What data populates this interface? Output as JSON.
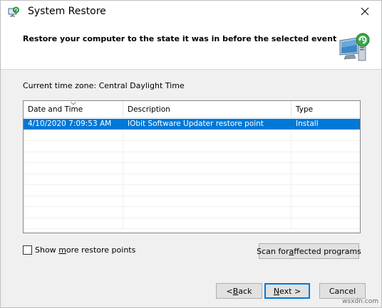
{
  "window": {
    "title": "System Restore"
  },
  "header": {
    "text": "Restore your computer to the state it was in before the selected event"
  },
  "timezone": {
    "text": "Current time zone: Central Daylight Time"
  },
  "table": {
    "columns": [
      "Date and Time",
      "Description",
      "Type"
    ],
    "rows": [
      {
        "date": "4/10/2020 7:09:53 AM",
        "description": "IObit Software Updater restore point",
        "type": "Install",
        "selected": true
      }
    ]
  },
  "controls": {
    "show_more_pre": "Show ",
    "show_more_accel": "m",
    "show_more_post": "ore restore points",
    "scan_pre": "Scan for ",
    "scan_accel": "a",
    "scan_post": "ffected programs",
    "back_pre": "< ",
    "back_accel": "B",
    "back_post": "ack",
    "next_pre": "",
    "next_accel": "N",
    "next_post": "ext >",
    "cancel_label": "Cancel"
  },
  "watermark": "wsxdn.com",
  "colors": {
    "selection": "#0078d7",
    "window_bg": "#f0f0f0",
    "header_bg": "#ffffff"
  },
  "icons": [
    "system-restore-icon",
    "close-icon",
    "restore-computer-icon",
    "sort-arrow-icon"
  ]
}
